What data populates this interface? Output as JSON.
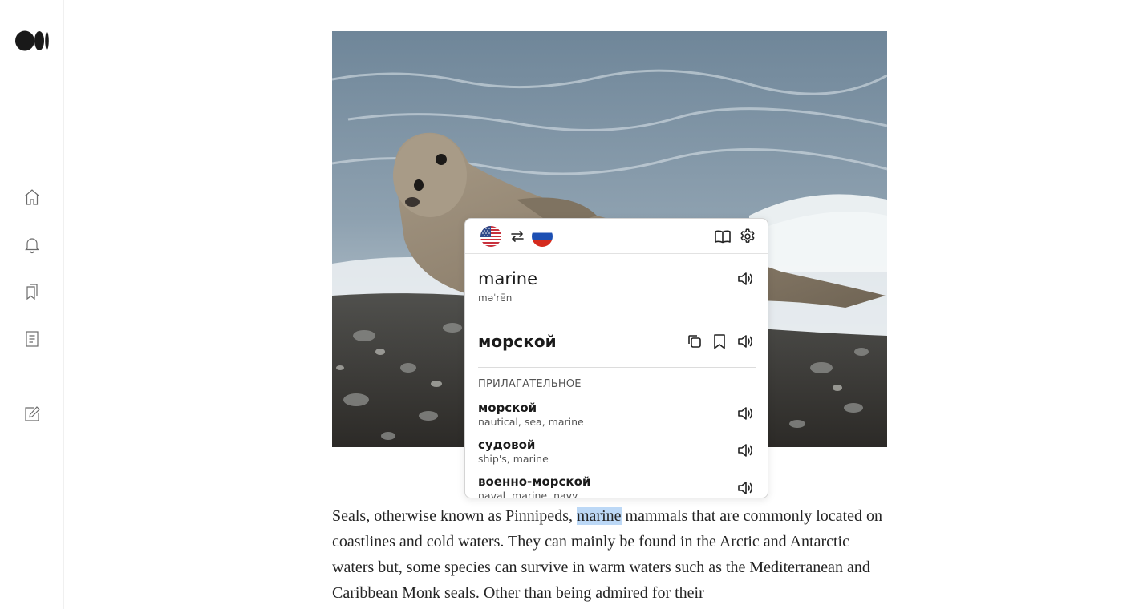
{
  "sidebar": {
    "logo": "medium-logo",
    "items": [
      {
        "name": "home-icon"
      },
      {
        "name": "bell-icon"
      },
      {
        "name": "bookmarks-icon"
      },
      {
        "name": "stories-icon"
      },
      {
        "name": "write-icon"
      }
    ]
  },
  "article": {
    "hero_alt": "seal lying on pebble beach with waves",
    "text_before": "Seals, otherwise known as Pinnipeds, ",
    "highlight": "marine",
    "text_after": " mammals that are commonly located on coastlines and cold waters. They can mainly be found in the Arctic and Antarctic waters but, some species can survive in warm waters such as the Mediterranean and Caribbean Monk seals. Other than being admired for their"
  },
  "translator": {
    "source_lang": "us-flag",
    "target_lang": "ru-flag",
    "word": "marine",
    "phonetic": "məˈrēn",
    "translation": "морской",
    "part_of_speech": "ПРИЛАГАТЕЛЬНОЕ",
    "meanings": [
      {
        "word": "морской",
        "synonyms": "nautical, sea, marine"
      },
      {
        "word": "судовой",
        "synonyms": "ship's, marine"
      },
      {
        "word": "военно-морской",
        "synonyms": "naval, marine, navy"
      }
    ]
  },
  "colors": {
    "highlight": "#bcd8f6",
    "text": "#242424"
  }
}
